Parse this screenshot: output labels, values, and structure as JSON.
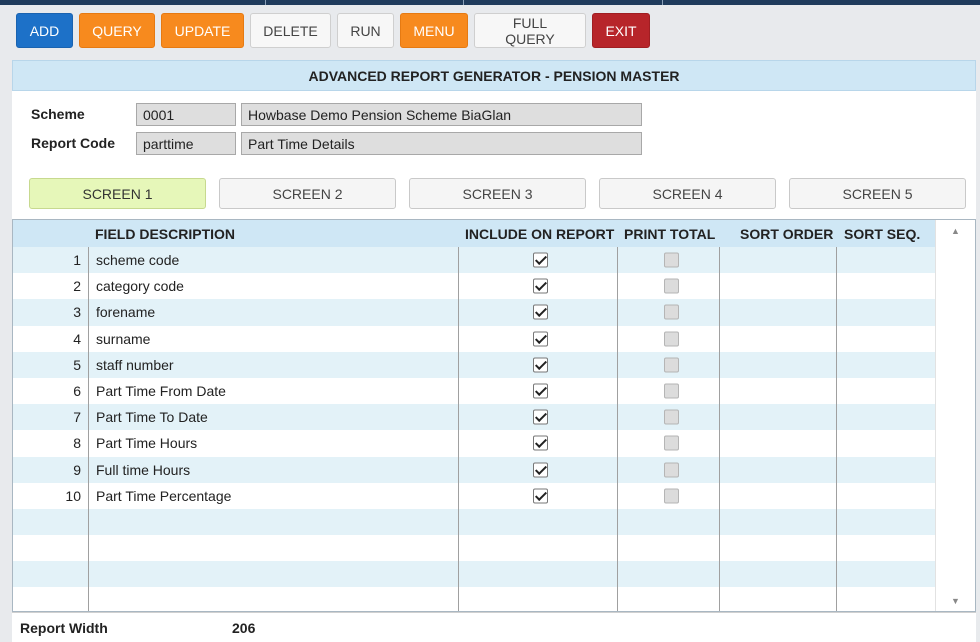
{
  "toolbar": {
    "add": "ADD",
    "query": "QUERY",
    "update": "UPDATE",
    "delete": "DELETE",
    "run": "RUN",
    "menu": "MENU",
    "full_query": "FULL QUERY",
    "exit": "EXIT"
  },
  "header": {
    "title": "ADVANCED REPORT GENERATOR - PENSION MASTER"
  },
  "form": {
    "scheme_label": "Scheme",
    "scheme_code": "0001",
    "scheme_name": "Howbase Demo Pension Scheme BiaGlan",
    "report_label": "Report Code",
    "report_code": "parttime",
    "report_name": "Part Time Details"
  },
  "tabs": [
    "SCREEN 1",
    "SCREEN 2",
    "SCREEN 3",
    "SCREEN 4",
    "SCREEN 5"
  ],
  "active_tab": "SCREEN 1",
  "grid": {
    "columns": [
      "FIELD DESCRIPTION",
      "INCLUDE ON REPORT",
      "PRINT TOTAL",
      "SORT ORDER",
      "SORT SEQ."
    ],
    "rows": [
      {
        "num": "1",
        "desc": "scheme code",
        "include": true,
        "total": false
      },
      {
        "num": "2",
        "desc": "category code",
        "include": true,
        "total": false
      },
      {
        "num": "3",
        "desc": "forename",
        "include": true,
        "total": false
      },
      {
        "num": "4",
        "desc": "surname",
        "include": true,
        "total": false
      },
      {
        "num": "5",
        "desc": "staff number",
        "include": true,
        "total": false
      },
      {
        "num": "6",
        "desc": "Part Time From Date",
        "include": true,
        "total": false
      },
      {
        "num": "7",
        "desc": "Part Time To Date",
        "include": true,
        "total": false
      },
      {
        "num": "8",
        "desc": "Part Time Hours",
        "include": true,
        "total": false
      },
      {
        "num": "9",
        "desc": "Full time Hours",
        "include": true,
        "total": false
      },
      {
        "num": "10",
        "desc": "Part Time Percentage",
        "include": true,
        "total": false
      }
    ],
    "empty_rows": 3
  },
  "footer": {
    "report_width_label": "Report Width",
    "report_width_value": "206"
  }
}
